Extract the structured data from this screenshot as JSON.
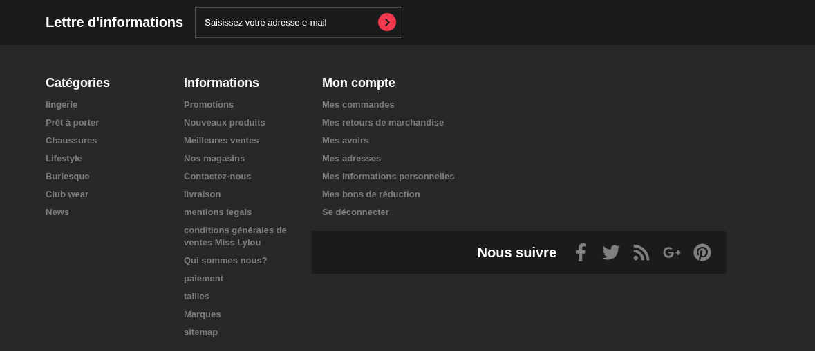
{
  "newsletter": {
    "title": "Lettre d'informations",
    "placeholder": "Saisissez votre adresse e-mail"
  },
  "columns": [
    {
      "title": "Catégories",
      "links": [
        "lingerie",
        "Prêt à porter",
        "Chaussures",
        "Lifestyle",
        "Burlesque",
        "Club wear",
        "News"
      ]
    },
    {
      "title": "Informations",
      "links": [
        "Promotions",
        "Nouveaux produits",
        "Meilleures ventes",
        "Nos magasins",
        "Contactez-nous",
        "livraison",
        "mentions legals",
        "conditions générales de ventes Miss Lylou",
        "Qui sommes nous?",
        "paiement",
        "tailles",
        "Marques",
        "sitemap"
      ]
    },
    {
      "title": "Mon compte",
      "links": [
        "Mes commandes",
        "Mes retours de marchandise",
        "Mes avoirs",
        "Mes adresses",
        "Mes informations personnelles",
        "Mes bons de réduction",
        "Se déconnecter"
      ]
    }
  ],
  "follow": {
    "title": "Nous suivre",
    "networks": [
      {
        "kind": "facebook"
      },
      {
        "kind": "twitter"
      },
      {
        "kind": "rss"
      },
      {
        "kind": "googleplus"
      },
      {
        "kind": "pinterest"
      }
    ]
  }
}
